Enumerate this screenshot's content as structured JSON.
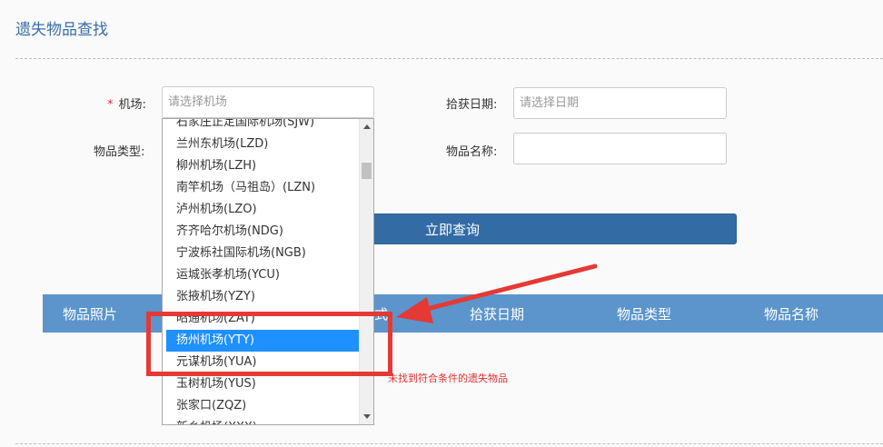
{
  "page": {
    "title": "遗失物品查找"
  },
  "form": {
    "airport": {
      "label": "机场:",
      "required_mark": "*",
      "placeholder": "请选择机场"
    },
    "pickup_date": {
      "label": "拾获日期:",
      "placeholder": "请选择日期"
    },
    "item_type": {
      "label": "物品类型:"
    },
    "item_name": {
      "label": "物品名称:"
    },
    "search_button": "立即查询"
  },
  "dropdown": {
    "items": [
      "石家庄正定国际机场(SJW)",
      "兰州东机场(LZD)",
      "柳州机场(LZH)",
      "南竿机场（马祖岛）(LZN)",
      "泸州机场(LZO)",
      "齐齐哈尔机场(NDG)",
      "宁波栎社国际机场(NGB)",
      "运城张孝机场(YCU)",
      "张掖机场(YZY)",
      "昭通机场(ZAT)",
      "扬州机场(YTY)",
      "元谋机场(YUA)",
      "玉树机场(YUS)",
      "张家口(ZQZ)",
      "新乡机场(XXX)"
    ],
    "selected_index": 10
  },
  "table": {
    "headers": [
      "物品照片",
      "式",
      "拾获日期",
      "物品类型",
      "物品名称"
    ],
    "empty_message": "未找到符合条件的遗失物品"
  },
  "annotation": {
    "color": "#e53935"
  }
}
